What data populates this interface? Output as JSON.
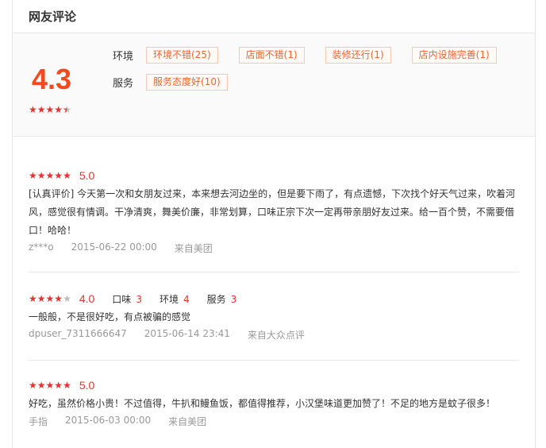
{
  "section_title": "网友评论",
  "summary": {
    "score": "4.3",
    "stars": {
      "full": 4,
      "half": 1,
      "off": 0
    },
    "rows": [
      {
        "label": "环境",
        "tags": [
          "环境不错(25)",
          "店面不错(1)",
          "装修还行(1)",
          "店内设施完善(1)"
        ]
      },
      {
        "label": "服务",
        "tags": [
          "服务态度好(10)"
        ]
      }
    ]
  },
  "reviews": [
    {
      "rating": "5.0",
      "stars": {
        "full": 5,
        "off": 0
      },
      "sub_scores": [],
      "content": "[认真评价] 今天第一次和女朋友过来，本来想去河边坐的，但是要下雨了，有点遗憾，下次找个好天气过来，吹着河风，感觉很有情调。干净清爽，舞美价廉，非常划算，口味正宗下次一定再带亲朋好友过来。给一百个赞，不需要借口！哈哈！",
      "user": "z***o",
      "date": "2015-06-22 00:00",
      "source": "来自美团"
    },
    {
      "rating": "4.0",
      "stars": {
        "full": 4,
        "off": 1
      },
      "sub_scores": [
        {
          "label": "口味",
          "value": "3"
        },
        {
          "label": "环境",
          "value": "4"
        },
        {
          "label": "服务",
          "value": "3"
        }
      ],
      "content": "一般般，不是很好吃，有点被骗的感觉",
      "user": "dpuser_7311666647",
      "date": "2015-06-14 23:41",
      "source": "来自大众点评"
    },
    {
      "rating": "5.0",
      "stars": {
        "full": 5,
        "off": 0
      },
      "sub_scores": [],
      "content": "好吃，虽然价格小贵！不过值得，牛扒和鳗鱼饭，都值得推荐，小汉堡味道更加赞了！不足的地方是蚊子很多！",
      "user": "手指",
      "date": "2015-06-03 00:00",
      "source": "来自美团"
    }
  ],
  "colors": {
    "accent": "#f24a1d",
    "star": "#e63131",
    "tag_border": "#f8c6b2",
    "tag_text": "#f0642f"
  },
  "icons": {
    "star": "star-icon"
  }
}
